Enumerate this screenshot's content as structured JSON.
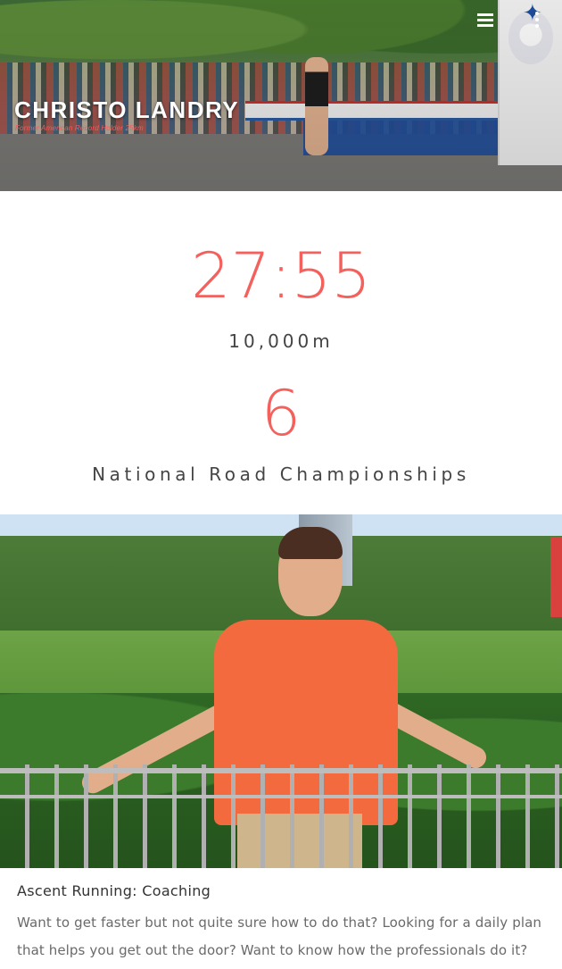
{
  "header": {
    "title": "CHRISTO LANDRY",
    "subtitle": "Former American Record Holder 25km",
    "menu_icon": "hamburger-menu-icon",
    "more_icon": "vertical-dots-icon"
  },
  "stats": [
    {
      "value": "27:55",
      "label": "10,000m"
    },
    {
      "value": "6",
      "label": "National Road Championships"
    }
  ],
  "article": {
    "title": "Ascent Running: Coaching",
    "body": "Want to get faster but not quite sure how to do that? Looking for a daily plan that helps you get out the door? Want to know how the professionals do it?"
  },
  "colors": {
    "accent": "#f4615d",
    "text": "#444444",
    "muted_text": "#6a6a6a"
  }
}
